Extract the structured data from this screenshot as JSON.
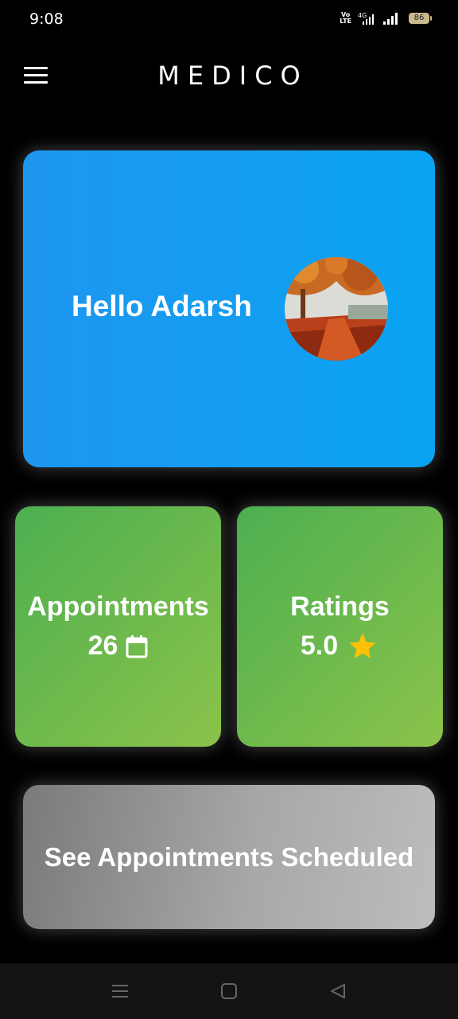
{
  "status_bar": {
    "time": "9:08",
    "network_label": "4G",
    "volte_label": "Vo LTE",
    "battery_level": "86"
  },
  "app_bar": {
    "title": "MEDICO",
    "menu_icon": "hamburger-menu-icon"
  },
  "greeting_card": {
    "text": "Hello Adarsh",
    "color": "#0aa3f2"
  },
  "appointments_card": {
    "label": "Appointments",
    "value": "26",
    "icon": "calendar-icon"
  },
  "ratings_card": {
    "label": "Ratings",
    "value": "5.0",
    "icon": "star-icon",
    "star_color": "#ffc107"
  },
  "see_appointments": {
    "label": "See Appointments Scheduled"
  },
  "nav_bar": {
    "icons": [
      "recent-apps-icon",
      "home-icon",
      "back-icon"
    ]
  }
}
